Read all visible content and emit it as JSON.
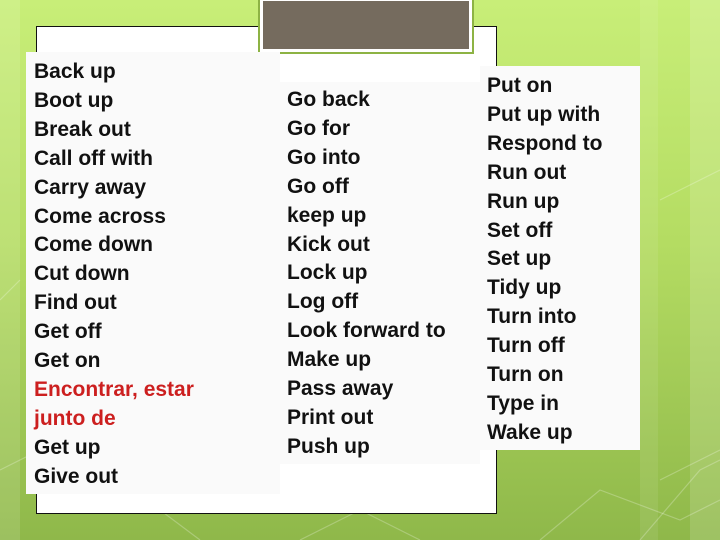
{
  "slide": {
    "columns": [
      {
        "items": [
          {
            "text": "Back up",
            "highlight": false
          },
          {
            "text": "Boot up",
            "highlight": false
          },
          {
            "text": "Break out",
            "highlight": false
          },
          {
            "text": "Call off with",
            "highlight": false
          },
          {
            "text": "Carry away",
            "highlight": false
          },
          {
            "text": "Come across",
            "highlight": false
          },
          {
            "text": "Come down",
            "highlight": false
          },
          {
            "text": "Cut down",
            "highlight": false
          },
          {
            "text": "Find out",
            "highlight": false
          },
          {
            "text": "Get off",
            "highlight": false
          },
          {
            "text": "Get on",
            "highlight": false
          },
          {
            "text": "Encontrar, estar",
            "highlight": true
          },
          {
            "text": "junto de",
            "highlight": true
          },
          {
            "text": "Get up",
            "highlight": false
          },
          {
            "text": "Give out",
            "highlight": false
          }
        ]
      },
      {
        "items": [
          {
            "text": "Go back",
            "highlight": false
          },
          {
            "text": "Go for",
            "highlight": false
          },
          {
            "text": "Go into",
            "highlight": false
          },
          {
            "text": "Go off",
            "highlight": false
          },
          {
            "text": "keep up",
            "highlight": false
          },
          {
            "text": "Kick out",
            "highlight": false
          },
          {
            "text": "Lock up",
            "highlight": false
          },
          {
            "text": "Log off",
            "highlight": false
          },
          {
            "text": "Look forward to",
            "highlight": false
          },
          {
            "text": "Make up",
            "highlight": false
          },
          {
            "text": "Pass away",
            "highlight": false
          },
          {
            "text": "Print out",
            "highlight": false
          },
          {
            "text": "Push up",
            "highlight": false
          }
        ]
      },
      {
        "items": [
          {
            "text": "Put on",
            "highlight": false
          },
          {
            "text": "Put up with",
            "highlight": false
          },
          {
            "text": "Respond to",
            "highlight": false
          },
          {
            "text": "Run out",
            "highlight": false
          },
          {
            "text": "Run up",
            "highlight": false
          },
          {
            "text": "Set off",
            "highlight": false
          },
          {
            "text": "Set up",
            "highlight": false
          },
          {
            "text": "Tidy up",
            "highlight": false
          },
          {
            "text": "Turn into",
            "highlight": false
          },
          {
            "text": "Turn off",
            "highlight": false
          },
          {
            "text": "Turn on",
            "highlight": false
          },
          {
            "text": "Type in",
            "highlight": false
          },
          {
            "text": "Wake up",
            "highlight": false
          }
        ]
      }
    ]
  },
  "colors": {
    "highlight": "#cc1f1f",
    "title_box": "#756b5e",
    "accent_green": "#8db344"
  }
}
